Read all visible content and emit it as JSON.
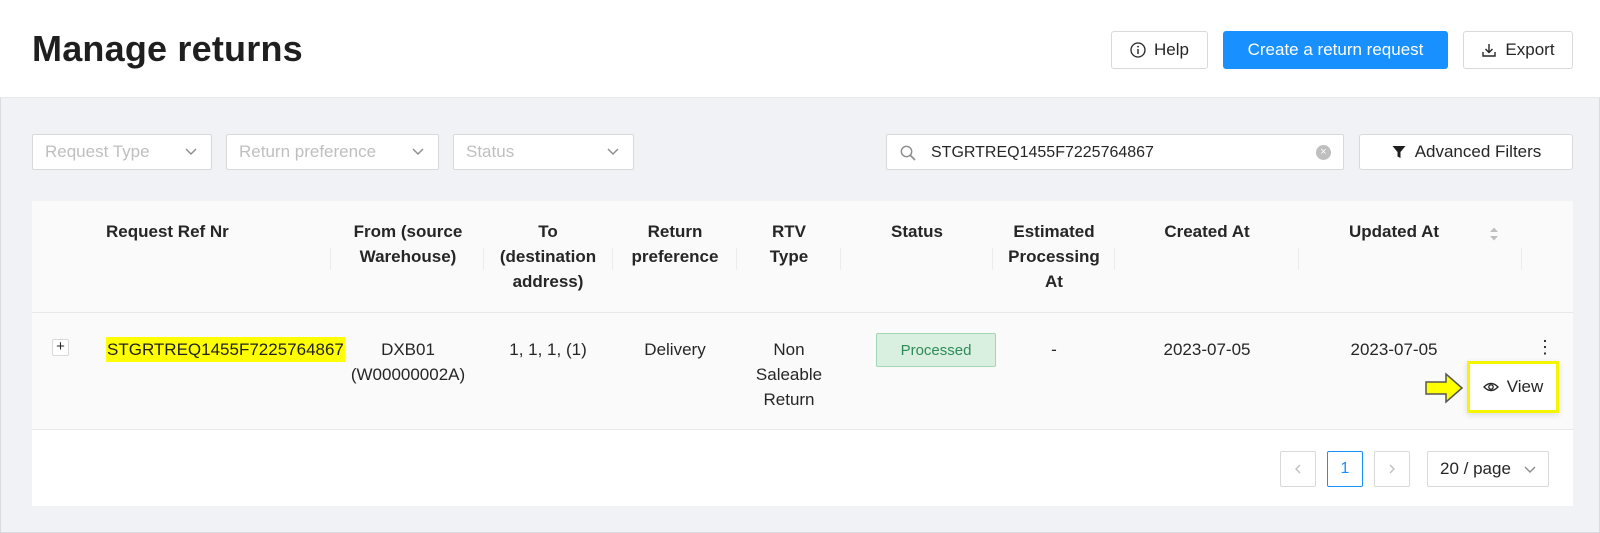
{
  "header": {
    "title": "Manage returns",
    "help_label": "Help",
    "create_label": "Create a return request",
    "export_label": "Export",
    "icons": {
      "help": "info-circle-icon",
      "export": "download-icon"
    }
  },
  "filters": {
    "request_type_placeholder": "Request Type",
    "return_preference_placeholder": "Return preference",
    "status_placeholder": "Status",
    "search_value": "STGRTREQ1455F7225764867",
    "advanced_label": "Advanced Filters"
  },
  "table": {
    "columns": [
      "Request Ref Nr",
      "From (source\nWarehouse)",
      "To\n(destination\naddress)",
      "Return\npreference",
      "RTV\nType",
      "Status",
      "Estimated\nProcessing\nAt",
      "Created At",
      "Updated At"
    ],
    "rows": [
      {
        "ref": "STGRTREQ1455F7225764867",
        "from": "DXB01\n(W00000002A)",
        "to": "1, 1, 1, (1)",
        "return_preference": "Delivery",
        "rtv_type": "Non\nSaleable\nReturn",
        "status": "Processed",
        "estimated": "-",
        "created_at": "2023-07-05",
        "updated_at": "2023-07-05"
      }
    ],
    "view_label": "View"
  },
  "pagination": {
    "current_page": "1",
    "page_size": "20 / page"
  },
  "colors": {
    "primary": "#1890ff",
    "highlight": "#ffff00",
    "status_bg": "#d9efe0",
    "status_text": "#2e8b57"
  }
}
